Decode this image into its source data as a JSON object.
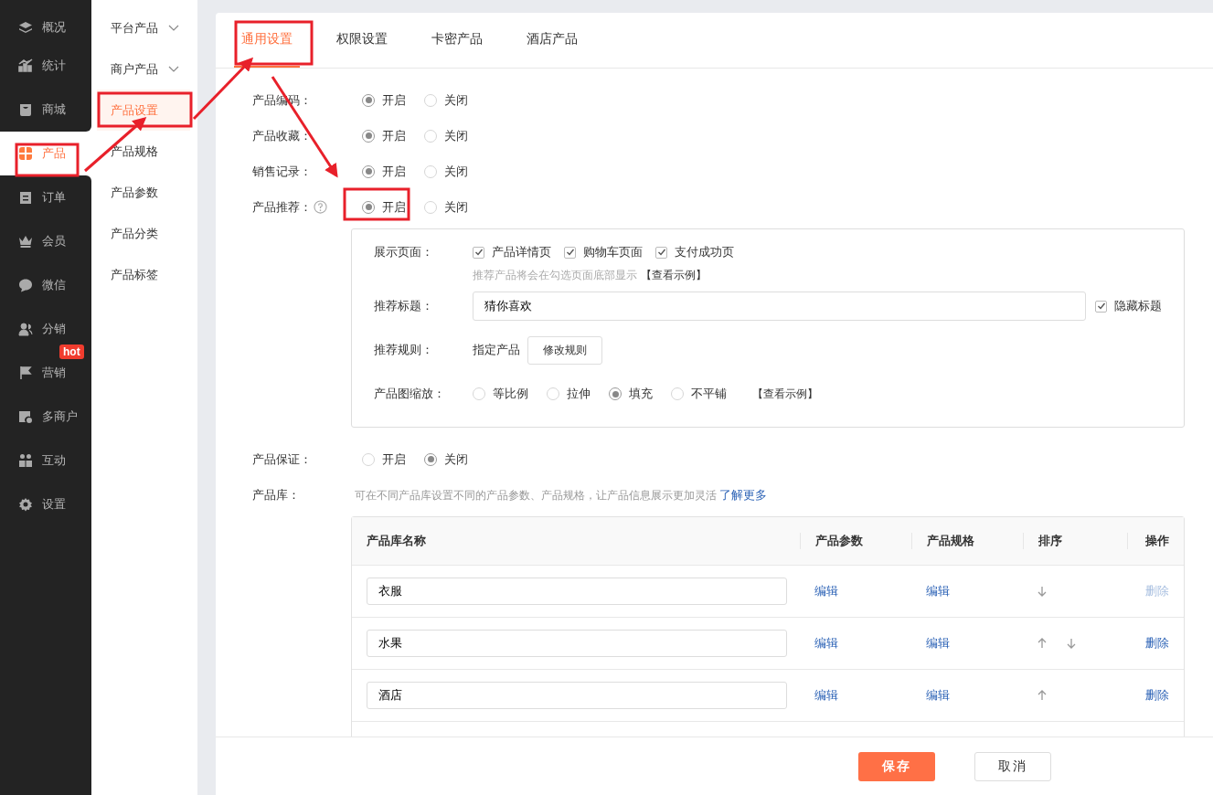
{
  "sidebar": {
    "items": [
      {
        "label": "概况",
        "selected": false
      },
      {
        "label": "统计",
        "selected": false
      },
      {
        "label": "商城",
        "selected": false
      },
      {
        "label": "产品",
        "selected": true
      },
      {
        "label": "订单",
        "selected": false
      },
      {
        "label": "会员",
        "selected": false
      },
      {
        "label": "微信",
        "selected": false
      },
      {
        "label": "分销",
        "selected": false
      },
      {
        "label": "营销",
        "selected": false,
        "badge": "hot"
      },
      {
        "label": "多商户",
        "selected": false
      },
      {
        "label": "互动",
        "selected": false
      },
      {
        "label": "设置",
        "selected": false
      }
    ]
  },
  "subnav": {
    "items": [
      {
        "label": "平台产品",
        "kind": "group",
        "selected": false
      },
      {
        "label": "商户产品",
        "kind": "group",
        "selected": false
      },
      {
        "label": "产品设置",
        "kind": "link",
        "selected": true
      },
      {
        "label": "产品规格",
        "kind": "link",
        "selected": false
      },
      {
        "label": "产品参数",
        "kind": "link",
        "selected": false
      },
      {
        "label": "产品分类",
        "kind": "link",
        "selected": false
      },
      {
        "label": "产品标签",
        "kind": "link",
        "selected": false
      }
    ]
  },
  "tabs": [
    {
      "label": "通用设置",
      "selected": true
    },
    {
      "label": "权限设置",
      "selected": false
    },
    {
      "label": "卡密产品",
      "selected": false
    },
    {
      "label": "酒店产品",
      "selected": false
    }
  ],
  "settings": [
    {
      "label": "产品编码：",
      "help": false,
      "options": [
        {
          "label": "开启",
          "selected": true
        },
        {
          "label": "关闭",
          "selected": false
        }
      ]
    },
    {
      "label": "产品收藏：",
      "help": false,
      "options": [
        {
          "label": "开启",
          "selected": true
        },
        {
          "label": "关闭",
          "selected": false
        }
      ]
    },
    {
      "label": "销售记录：",
      "help": false,
      "options": [
        {
          "label": "开启",
          "selected": true
        },
        {
          "label": "关闭",
          "selected": false
        }
      ]
    },
    {
      "label": "产品推荐：",
      "help": true,
      "options": [
        {
          "label": "开启",
          "selected": true
        },
        {
          "label": "关闭",
          "selected": false
        }
      ]
    }
  ],
  "recommend": {
    "display_pages": {
      "label": "展示页面：",
      "options": [
        {
          "label": "产品详情页",
          "checked": true
        },
        {
          "label": "购物车页面",
          "checked": true
        },
        {
          "label": "支付成功页",
          "checked": true
        }
      ],
      "hint": "推荐产品将会在勾选页面底部显示",
      "link": "【查看示例】"
    },
    "title": {
      "label": "推荐标题：",
      "value": "猜你喜欢",
      "hide": {
        "label": "隐藏标题",
        "checked": true
      }
    },
    "rule": {
      "label": "推荐规则：",
      "value": "指定产品",
      "button": "修改规则"
    },
    "scale": {
      "label": "产品图缩放：",
      "options": [
        {
          "label": "等比例",
          "selected": false
        },
        {
          "label": "拉伸",
          "selected": false
        },
        {
          "label": "填充",
          "selected": true
        },
        {
          "label": "不平铺",
          "selected": false
        }
      ],
      "link": "【查看示例】"
    }
  },
  "guarantee": {
    "label": "产品保证：",
    "options": [
      {
        "label": "开启",
        "selected": false
      },
      {
        "label": "关闭",
        "selected": true
      }
    ]
  },
  "library": {
    "label": "产品库：",
    "description": "可在不同产品库设置不同的产品参数、产品规格，让产品信息展示更加灵活",
    "link": "了解更多",
    "columns": [
      "产品库名称",
      "产品参数",
      "产品规格",
      "排序",
      "操作"
    ],
    "rows": [
      {
        "name": "衣服",
        "params": "编辑",
        "specs": "编辑",
        "up": false,
        "down": true,
        "delete": "删除",
        "delete_disabled": true
      },
      {
        "name": "水果",
        "params": "编辑",
        "specs": "编辑",
        "up": true,
        "down": true,
        "delete": "删除",
        "delete_disabled": false
      },
      {
        "name": "酒店",
        "params": "编辑",
        "specs": "编辑",
        "up": true,
        "down": false,
        "delete": "删除",
        "delete_disabled": false
      }
    ]
  },
  "footer": {
    "save": "保存",
    "cancel": "取消"
  }
}
